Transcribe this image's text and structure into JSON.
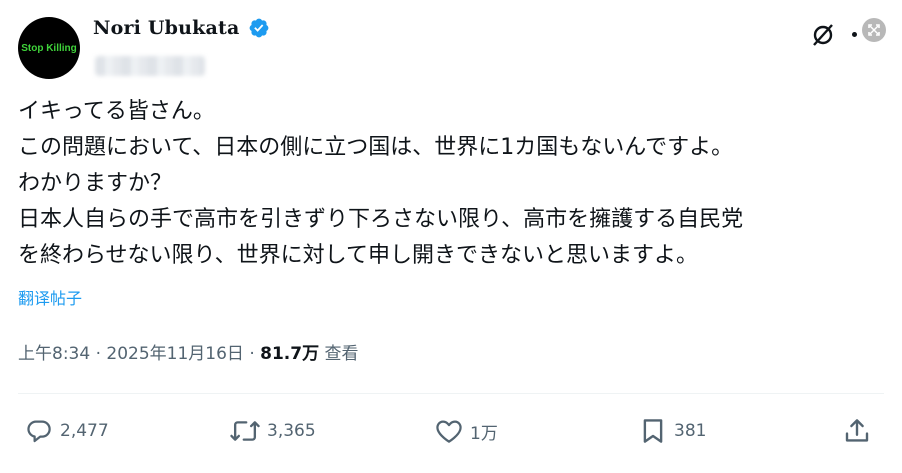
{
  "author": {
    "avatar_text": "Stop Killing",
    "display_name": "Nori Ubukata",
    "verified": true
  },
  "tweet": {
    "lines": [
      "イキってる皆さん。",
      "この問題において、日本の側に立つ国は、世界に1カ国もないんですよ。",
      "わかりますか？",
      "日本人自らの手で高市を引きずり下ろさない限り、高市を擁護する自民党",
      "を終わらせない限り、世界に対して申し開きできないと思いますよ。"
    ],
    "translate_label": "翻译帖子"
  },
  "meta": {
    "timestamp": "上午8:34 · 2025年11月16日 · ",
    "views_count": "81.7万",
    "views_label": " 查看"
  },
  "actions": {
    "replies": "2,477",
    "reposts": "3,365",
    "likes": "1万",
    "bookmarks": "381"
  },
  "colors": {
    "accent": "#1d9bf0",
    "text_primary": "#0f1419",
    "text_secondary": "#536471",
    "avatar_text": "#3fd23a"
  },
  "icons": [
    "grok-icon",
    "more-icon",
    "expand-icon",
    "verified-badge-icon",
    "reply-icon",
    "repost-icon",
    "like-icon",
    "bookmark-icon",
    "share-icon"
  ]
}
